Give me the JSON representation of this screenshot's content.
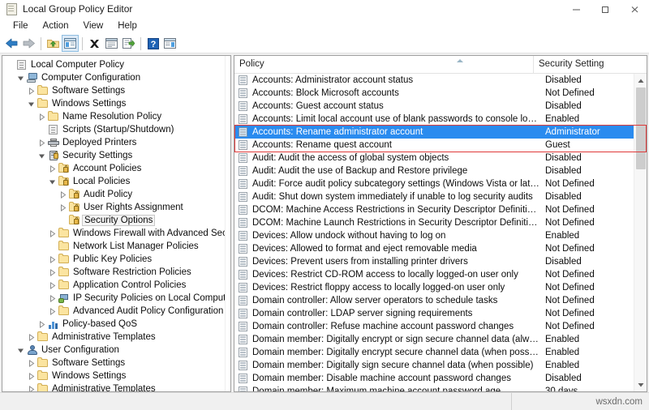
{
  "window": {
    "title": "Local Group Policy Editor",
    "icon": "policy-document-icon",
    "controls": {
      "minimize": "—",
      "maximize": "❐",
      "close": "✕"
    }
  },
  "menubar": {
    "items": [
      {
        "label": "File"
      },
      {
        "label": "Action"
      },
      {
        "label": "View"
      },
      {
        "label": "Help"
      }
    ]
  },
  "toolbar": {
    "buttons": [
      {
        "name": "back-icon"
      },
      {
        "name": "forward-icon"
      },
      {
        "name": "up-folder-icon"
      },
      {
        "name": "show-hide-console-tree-icon"
      },
      {
        "name": "delete-icon"
      },
      {
        "name": "properties-icon"
      },
      {
        "name": "export-list-icon"
      },
      {
        "name": "help-icon"
      },
      {
        "name": "show-hide-action-pane-icon"
      }
    ]
  },
  "tree": {
    "nodes": [
      {
        "label": "Local Computer Policy",
        "indent": 0,
        "twist": "none",
        "icon": "policy-document-icon"
      },
      {
        "label": "Computer Configuration",
        "indent": 1,
        "twist": "expanded",
        "icon": "computer-icon"
      },
      {
        "label": "Software Settings",
        "indent": 2,
        "twist": "collapsed",
        "icon": "folder-icon"
      },
      {
        "label": "Windows Settings",
        "indent": 2,
        "twist": "expanded",
        "icon": "folder-icon"
      },
      {
        "label": "Name Resolution Policy",
        "indent": 3,
        "twist": "collapsed",
        "icon": "folder-icon"
      },
      {
        "label": "Scripts (Startup/Shutdown)",
        "indent": 3,
        "twist": "none",
        "icon": "script-icon"
      },
      {
        "label": "Deployed Printers",
        "indent": 3,
        "twist": "collapsed",
        "icon": "printer-icon"
      },
      {
        "label": "Security Settings",
        "indent": 3,
        "twist": "expanded",
        "icon": "security-settings-icon"
      },
      {
        "label": "Account Policies",
        "indent": 4,
        "twist": "collapsed",
        "icon": "folder-lock-icon"
      },
      {
        "label": "Local Policies",
        "indent": 4,
        "twist": "expanded",
        "icon": "folder-lock-icon"
      },
      {
        "label": "Audit Policy",
        "indent": 5,
        "twist": "collapsed",
        "icon": "folder-lock-icon"
      },
      {
        "label": "User Rights Assignment",
        "indent": 5,
        "twist": "collapsed",
        "icon": "folder-lock-icon"
      },
      {
        "label": "Security Options",
        "indent": 5,
        "twist": "none",
        "icon": "folder-lock-icon",
        "selected": true
      },
      {
        "label": "Windows Firewall with Advanced Security",
        "indent": 4,
        "twist": "collapsed",
        "icon": "folder-icon"
      },
      {
        "label": "Network List Manager Policies",
        "indent": 4,
        "twist": "none",
        "icon": "folder-icon"
      },
      {
        "label": "Public Key Policies",
        "indent": 4,
        "twist": "collapsed",
        "icon": "folder-icon"
      },
      {
        "label": "Software Restriction Policies",
        "indent": 4,
        "twist": "collapsed",
        "icon": "folder-icon"
      },
      {
        "label": "Application Control Policies",
        "indent": 4,
        "twist": "collapsed",
        "icon": "folder-icon"
      },
      {
        "label": "IP Security Policies on Local Computer",
        "indent": 4,
        "twist": "collapsed",
        "icon": "ipsec-icon"
      },
      {
        "label": "Advanced Audit Policy Configuration",
        "indent": 4,
        "twist": "collapsed",
        "icon": "folder-icon"
      },
      {
        "label": "Policy-based QoS",
        "indent": 3,
        "twist": "collapsed",
        "icon": "qos-chart-icon"
      },
      {
        "label": "Administrative Templates",
        "indent": 2,
        "twist": "collapsed",
        "icon": "folder-icon"
      },
      {
        "label": "User Configuration",
        "indent": 1,
        "twist": "expanded",
        "icon": "user-icon"
      },
      {
        "label": "Software Settings",
        "indent": 2,
        "twist": "collapsed",
        "icon": "folder-icon"
      },
      {
        "label": "Windows Settings",
        "indent": 2,
        "twist": "collapsed",
        "icon": "folder-icon"
      },
      {
        "label": "Administrative Templates",
        "indent": 2,
        "twist": "collapsed",
        "icon": "folder-icon"
      }
    ]
  },
  "list": {
    "columns": [
      {
        "label": "Policy",
        "sort": "ascending"
      },
      {
        "label": "Security Setting"
      }
    ],
    "rows": [
      {
        "policy": "Accounts: Administrator account status",
        "setting": "Disabled"
      },
      {
        "policy": "Accounts: Block Microsoft accounts",
        "setting": "Not Defined"
      },
      {
        "policy": "Accounts: Guest account status",
        "setting": "Disabled"
      },
      {
        "policy": "Accounts: Limit local account use of blank passwords to console logon only",
        "setting": "Enabled"
      },
      {
        "policy": "Accounts: Rename administrator account",
        "setting": "Administrator",
        "selected": true
      },
      {
        "policy": "Accounts: Rename quest account",
        "setting": "Guest"
      },
      {
        "policy": "Audit: Audit the access of global system objects",
        "setting": "Disabled"
      },
      {
        "policy": "Audit: Audit the use of Backup and Restore privilege",
        "setting": "Disabled"
      },
      {
        "policy": "Audit: Force audit policy subcategory settings (Windows Vista or later) to ov...",
        "setting": "Not Defined"
      },
      {
        "policy": "Audit: Shut down system immediately if unable to log security audits",
        "setting": "Disabled"
      },
      {
        "policy": "DCOM: Machine Access Restrictions in Security Descriptor Definition Langua...",
        "setting": "Not Defined"
      },
      {
        "policy": "DCOM: Machine Launch Restrictions in Security Descriptor Definition Langu...",
        "setting": "Not Defined"
      },
      {
        "policy": "Devices: Allow undock without having to log on",
        "setting": "Enabled"
      },
      {
        "policy": "Devices: Allowed to format and eject removable media",
        "setting": "Not Defined"
      },
      {
        "policy": "Devices: Prevent users from installing printer drivers",
        "setting": "Disabled"
      },
      {
        "policy": "Devices: Restrict CD-ROM access to locally logged-on user only",
        "setting": "Not Defined"
      },
      {
        "policy": "Devices: Restrict floppy access to locally logged-on user only",
        "setting": "Not Defined"
      },
      {
        "policy": "Domain controller: Allow server operators to schedule tasks",
        "setting": "Not Defined"
      },
      {
        "policy": "Domain controller: LDAP server signing requirements",
        "setting": "Not Defined"
      },
      {
        "policy": "Domain controller: Refuse machine account password changes",
        "setting": "Not Defined"
      },
      {
        "policy": "Domain member: Digitally encrypt or sign secure channel data (always)",
        "setting": "Enabled"
      },
      {
        "policy": "Domain member: Digitally encrypt secure channel data (when possible)",
        "setting": "Enabled"
      },
      {
        "policy": "Domain member: Digitally sign secure channel data (when possible)",
        "setting": "Enabled"
      },
      {
        "policy": "Domain member: Disable machine account password changes",
        "setting": "Disabled"
      },
      {
        "policy": "Domain member: Maximum machine account password age",
        "setting": "30 days"
      }
    ]
  },
  "annotation": {
    "highlight_color": "#e03a3a",
    "selection_color": "#2a8bef"
  },
  "statusbar": {
    "watermark": "wsxdn.com"
  }
}
